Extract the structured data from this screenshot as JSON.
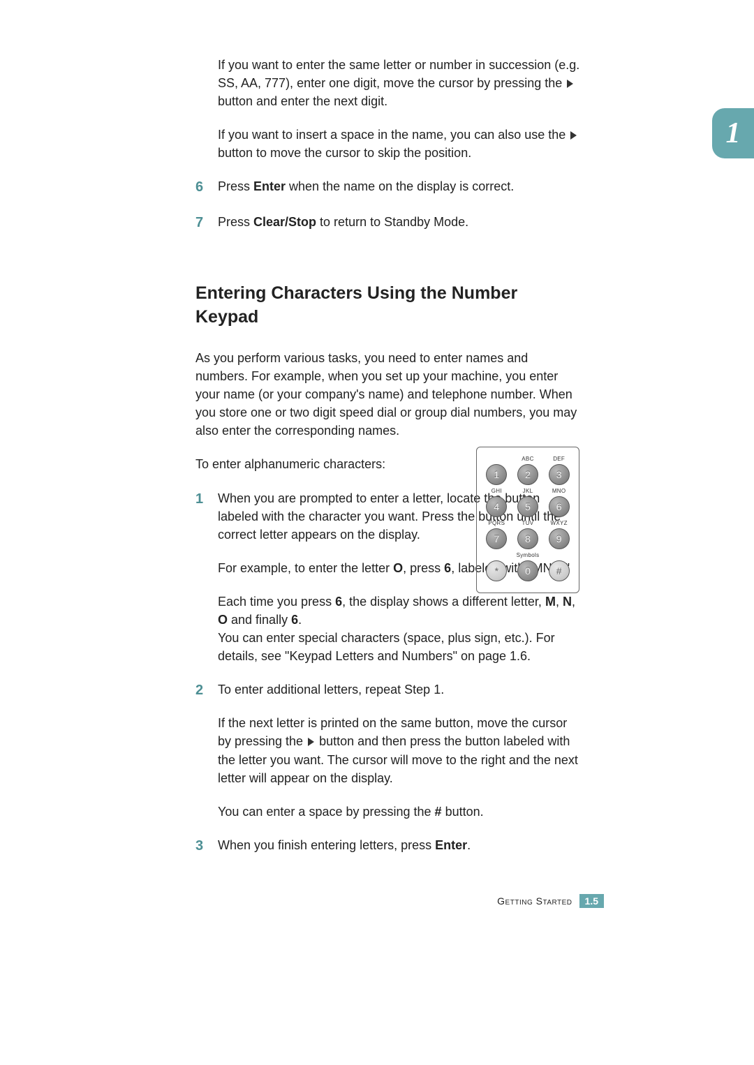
{
  "chapter_tab": "1",
  "footer": {
    "label": "Getting Started",
    "page": "1.5"
  },
  "intro": {
    "p1a": "If you want to enter the same letter or number in succession (e.g. SS, AA, 777), enter one digit, move the cursor by pressing the",
    "p1b": "button and enter the next digit.",
    "p2a": "If you want to insert a space in the name, you can also use the",
    "p2b": "button to move the cursor to skip the position."
  },
  "step6": {
    "num": "6",
    "a": "Press ",
    "bold": "Enter",
    "b": " when the name on the display is correct."
  },
  "step7": {
    "num": "7",
    "a": "Press ",
    "bold": "Clear/Stop",
    "b": " to return to Standby Mode."
  },
  "section_title": "Entering Characters Using the Number Keypad",
  "section_intro": "As you perform various tasks, you need to enter names and numbers. For example, when you set up your machine, you enter your name (or your company's name) and telephone number. When you store one or two digit speed dial or group dial numbers, you may also enter the corresponding names.",
  "section_lead": "To enter alphanumeric characters:",
  "s1": {
    "num": "1",
    "p1": "When you are prompted to enter a letter, locate the button labeled with the character you want. Press the button until the correct letter appears on the display.",
    "p2a": "For example, to enter the letter ",
    "p2b": "O",
    "p2c": ", press ",
    "p2d": "6",
    "p2e": ", labeled with \"MNO.\"",
    "p3a": "Each time you press ",
    "p3b": "6",
    "p3c": ", the display shows a different letter, ",
    "p3d": "M",
    "p3e": ", ",
    "p3f": "N",
    "p3g": ", ",
    "p3h": "O",
    "p3i": " and finally ",
    "p3j": "6",
    "p3k": ".",
    "p4": "You can enter special characters (space, plus sign, etc.). For details, see \"Keypad Letters and Numbers\" on page 1.6."
  },
  "s2": {
    "num": "2",
    "p1": "To enter additional letters, repeat Step 1.",
    "p2a": "If the next letter is printed on the same button, move the cursor by pressing the ",
    "p2b": " button and then press the button labeled with the letter you want. The cursor will move to the right and the next letter will appear on the display.",
    "p3a": "You can enter a space by pressing the ",
    "p3hash": "#",
    "p3b": " button."
  },
  "s3": {
    "num": "3",
    "a": "When you finish entering letters, press ",
    "bold": "Enter",
    "b": "."
  },
  "keypad": {
    "labels": {
      "r1": [
        "",
        "ABC",
        "DEF"
      ],
      "r2": [
        "GHI",
        "JKL",
        "MNO"
      ],
      "r3": [
        "PQRS",
        "TUV",
        "WXYZ"
      ],
      "r4": [
        "",
        "Symbols",
        ""
      ]
    },
    "keys": {
      "r1": [
        "1",
        "2",
        "3"
      ],
      "r2": [
        "4",
        "5",
        "6"
      ],
      "r3": [
        "7",
        "8",
        "9"
      ],
      "r4": [
        "*",
        "0",
        "#"
      ]
    }
  }
}
